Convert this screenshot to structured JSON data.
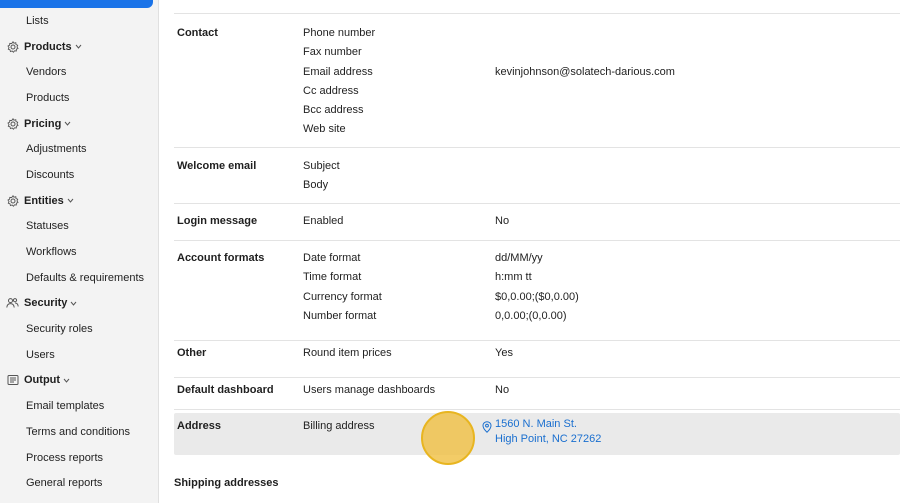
{
  "sidebar": {
    "items": [
      {
        "type": "item",
        "label": "Lists"
      },
      {
        "type": "section",
        "label": "Products",
        "icon": "gear-icon"
      },
      {
        "type": "item",
        "label": "Vendors"
      },
      {
        "type": "item",
        "label": "Products"
      },
      {
        "type": "section",
        "label": "Pricing",
        "icon": "gear-icon"
      },
      {
        "type": "item",
        "label": "Adjustments"
      },
      {
        "type": "item",
        "label": "Discounts"
      },
      {
        "type": "section",
        "label": "Entities",
        "icon": "gear-icon"
      },
      {
        "type": "item",
        "label": "Statuses"
      },
      {
        "type": "item",
        "label": "Workflows"
      },
      {
        "type": "item",
        "label": "Defaults & requirements"
      },
      {
        "type": "section",
        "label": "Security",
        "icon": "users-icon"
      },
      {
        "type": "item",
        "label": "Security roles"
      },
      {
        "type": "item",
        "label": "Users"
      },
      {
        "type": "section",
        "label": "Output",
        "icon": "output-icon"
      },
      {
        "type": "item",
        "label": "Email templates"
      },
      {
        "type": "item",
        "label": "Terms and conditions"
      },
      {
        "type": "item",
        "label": "Process reports"
      },
      {
        "type": "item",
        "label": "General reports"
      }
    ]
  },
  "details": {
    "contact": {
      "label": "Contact",
      "fields": [
        "Phone number",
        "Fax number",
        "Email address",
        "Cc address",
        "Bcc address",
        "Web site"
      ],
      "email_value": "kevinjohnson@solatech-darious.com"
    },
    "welcome_email": {
      "label": "Welcome email",
      "fields": [
        "Subject",
        "Body"
      ]
    },
    "login_message": {
      "label": "Login message",
      "field": "Enabled",
      "value": "No"
    },
    "account_formats": {
      "label": "Account formats",
      "fields": [
        "Date format",
        "Time format",
        "Currency format",
        "Number format"
      ],
      "values": [
        "dd/MM/yy",
        "h:mm tt",
        "$0,0.00;($0,0.00)",
        "0,0.00;(0,0.00)"
      ]
    },
    "other": {
      "label": "Other",
      "field": "Round item prices",
      "value": "Yes"
    },
    "default_dashboard": {
      "label": "Default dashboard",
      "field": "Users manage dashboards",
      "value": "No"
    },
    "address": {
      "label": "Address",
      "field": "Billing address",
      "line1": "1560 N. Main St.",
      "line2": "High Point, NC 27262"
    }
  },
  "shipping_heading": "Shipping addresses",
  "colors": {
    "accent": "#1a73e8",
    "link": "#1a6fcf",
    "cursor": "#f0be3c"
  }
}
